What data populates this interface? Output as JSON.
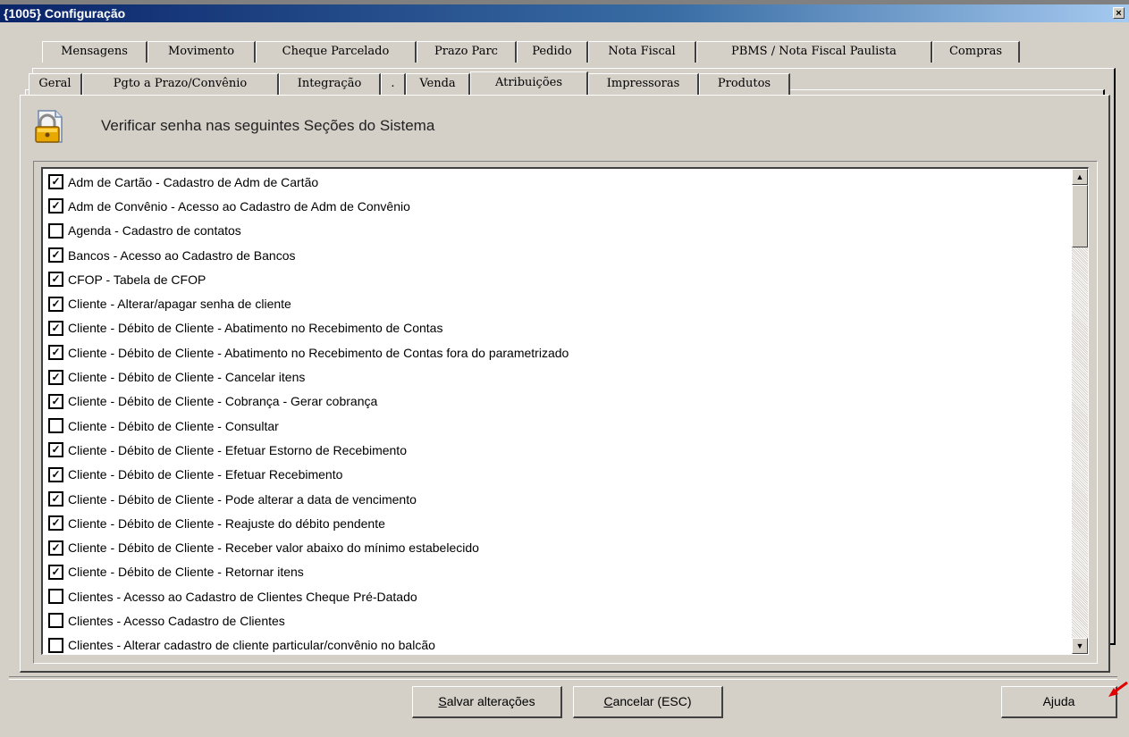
{
  "window": {
    "title": "{1005} Configuração",
    "close_glyph": "×"
  },
  "tabs_row1": [
    "Mensagens",
    "Movimento",
    "Cheque Parcelado",
    "Prazo Parc",
    "Pedido",
    "Nota Fiscal",
    "PBMS / Nota Fiscal Paulista",
    "Compras"
  ],
  "tabs_row2": [
    "Geral",
    "Pgto a Prazo/Convênio",
    "Integração",
    ".",
    "Venda",
    "Atribuições",
    "Impressoras",
    "Produtos"
  ],
  "active_tab": "Atribuições",
  "header": {
    "icon": "lock-icon",
    "text": "Verificar senha nas seguintes Seções do Sistema"
  },
  "checklist": [
    {
      "label": "Adm de Cartão - Cadastro de Adm de Cartão",
      "checked": "✓"
    },
    {
      "label": "Adm de Convênio - Acesso ao Cadastro de Adm de Convênio",
      "checked": "✓"
    },
    {
      "label": "Agenda - Cadastro de contatos",
      "checked": ""
    },
    {
      "label": "Bancos -  Acesso ao Cadastro de Bancos",
      "checked": "✓"
    },
    {
      "label": "CFOP - Tabela de CFOP",
      "checked": "✓"
    },
    {
      "label": "Cliente - Alterar/apagar senha de cliente",
      "checked": "✓"
    },
    {
      "label": "Cliente - Débito de Cliente - Abatimento no Recebimento de Contas",
      "checked": "✓"
    },
    {
      "label": "Cliente - Débito de Cliente - Abatimento no Recebimento de Contas fora do parametrizado",
      "checked": "✓"
    },
    {
      "label": "Cliente - Débito de Cliente - Cancelar itens",
      "checked": "✓"
    },
    {
      "label": "Cliente - Débito de Cliente - Cobrança - Gerar cobrança",
      "checked": "✓"
    },
    {
      "label": "Cliente - Débito de Cliente - Consultar",
      "checked": ""
    },
    {
      "label": "Cliente - Débito de Cliente - Efetuar Estorno de Recebimento",
      "checked": "✓"
    },
    {
      "label": "Cliente - Débito de Cliente - Efetuar Recebimento",
      "checked": "✓"
    },
    {
      "label": "Cliente - Débito de Cliente - Pode alterar a data de vencimento",
      "checked": "✓"
    },
    {
      "label": "Cliente - Débito de Cliente - Reajuste do débito pendente",
      "checked": "✓"
    },
    {
      "label": "Cliente - Débito de Cliente - Receber valor abaixo do mínimo estabelecido",
      "checked": "✓"
    },
    {
      "label": "Cliente - Débito de Cliente - Retornar itens",
      "checked": "✓"
    },
    {
      "label": "Clientes - Acesso ao Cadastro de Clientes Cheque Pré-Datado",
      "checked": ""
    },
    {
      "label": "Clientes - Acesso Cadastro de Clientes",
      "checked": ""
    },
    {
      "label": "Clientes - Alterar cadastro de cliente particular/convênio no balcão",
      "checked": ""
    }
  ],
  "scroll": {
    "up_glyph": "▲",
    "down_glyph": "▼"
  },
  "buttons": {
    "save_mnemonic": "S",
    "save_rest": "alvar alterações",
    "cancel_mnemonic": "C",
    "cancel_rest": "ancelar (ESC)",
    "help": "Ajuda"
  }
}
